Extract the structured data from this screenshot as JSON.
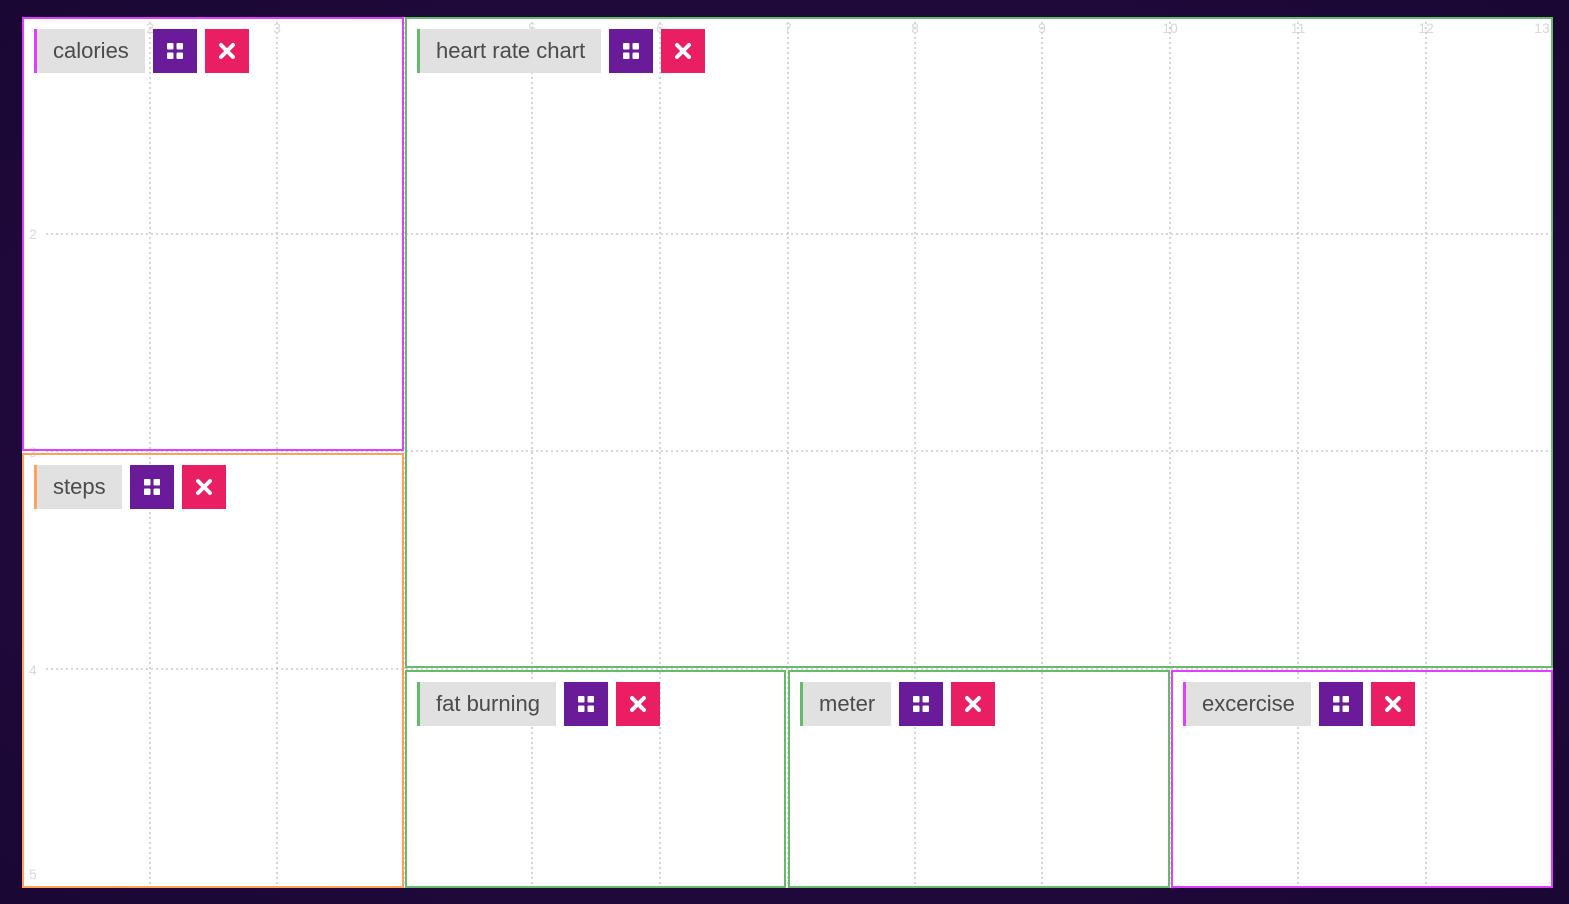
{
  "colors": {
    "background": "#1f0a3c",
    "move_button": "#6a1b9a",
    "close_button": "#e91e63",
    "title_bg": "#e1e1e1",
    "title_text": "#4b4b4b",
    "border_pink": "#e040fb",
    "border_green": "#66bb6a",
    "border_orange": "#ffa15a"
  },
  "grid": {
    "column_labels": [
      "2",
      "3",
      "5",
      "6",
      "7",
      "8",
      "9",
      "10",
      "11",
      "12",
      "13"
    ],
    "row_labels": [
      "2",
      "3",
      "4",
      "5"
    ]
  },
  "widgets": [
    {
      "id": "calories",
      "title": "calories",
      "accent": "#e040fb",
      "move_icon": "grid-icon",
      "close_icon": "close-icon"
    },
    {
      "id": "heart-rate-chart",
      "title": "heart rate chart",
      "accent": "#66bb6a",
      "move_icon": "grid-icon",
      "close_icon": "close-icon"
    },
    {
      "id": "steps",
      "title": "steps",
      "accent": "#ffa15a",
      "move_icon": "grid-icon",
      "close_icon": "close-icon"
    },
    {
      "id": "fat-burning",
      "title": "fat burning",
      "accent": "#66bb6a",
      "move_icon": "grid-icon",
      "close_icon": "close-icon"
    },
    {
      "id": "meter",
      "title": "meter",
      "accent": "#66bb6a",
      "move_icon": "grid-icon",
      "close_icon": "close-icon"
    },
    {
      "id": "excercise",
      "title": "excercise",
      "accent": "#e040fb",
      "move_icon": "grid-icon",
      "close_icon": "close-icon"
    }
  ]
}
